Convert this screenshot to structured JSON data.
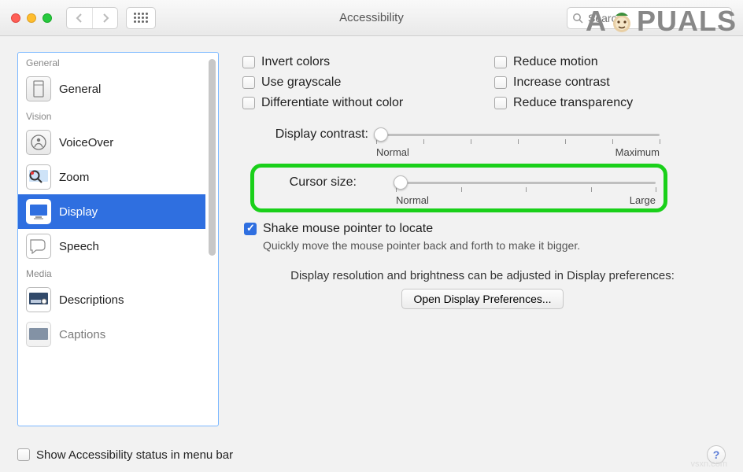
{
  "window": {
    "title": "Accessibility",
    "search_placeholder": "Search"
  },
  "sidebar": {
    "scrollable": true,
    "sections": [
      {
        "header": "General",
        "items": [
          {
            "label": "General",
            "icon": "general-icon",
            "selected": false
          }
        ]
      },
      {
        "header": "Vision",
        "items": [
          {
            "label": "VoiceOver",
            "icon": "voiceover-icon",
            "selected": false
          },
          {
            "label": "Zoom",
            "icon": "zoom-icon",
            "selected": false
          },
          {
            "label": "Display",
            "icon": "display-icon",
            "selected": true
          },
          {
            "label": "Speech",
            "icon": "speech-icon",
            "selected": false
          }
        ]
      },
      {
        "header": "Media",
        "items": [
          {
            "label": "Descriptions",
            "icon": "descriptions-icon",
            "selected": false
          },
          {
            "label": "Captions",
            "icon": "captions-icon",
            "selected": false
          }
        ]
      }
    ]
  },
  "checkboxes": {
    "invert_colors": {
      "label": "Invert colors",
      "checked": false
    },
    "use_grayscale": {
      "label": "Use grayscale",
      "checked": false
    },
    "differentiate": {
      "label": "Differentiate without color",
      "checked": false
    },
    "reduce_motion": {
      "label": "Reduce motion",
      "checked": false
    },
    "increase_contrast": {
      "label": "Increase contrast",
      "checked": false
    },
    "reduce_transparency": {
      "label": "Reduce transparency",
      "checked": false
    },
    "shake_to_locate": {
      "label": "Shake mouse pointer to locate",
      "checked": true
    }
  },
  "sliders": {
    "display_contrast": {
      "label": "Display contrast:",
      "min_label": "Normal",
      "max_label": "Maximum",
      "value_pct": 0
    },
    "cursor_size": {
      "label": "Cursor size:",
      "min_label": "Normal",
      "max_label": "Large",
      "value_pct": 0
    }
  },
  "hints": {
    "shake": "Quickly move the mouse pointer back and forth to make it bigger.",
    "display_pref": "Display resolution and brightness can be adjusted in Display preferences:"
  },
  "buttons": {
    "open_display_prefs": "Open Display Preferences...",
    "help": "?"
  },
  "footer": {
    "show_status_label": "Show Accessibility status in menu bar",
    "show_status_checked": false
  },
  "watermarks": {
    "appuals_left": "A",
    "appuals_right": "PUALS",
    "vsxn": "vsxn.com"
  }
}
